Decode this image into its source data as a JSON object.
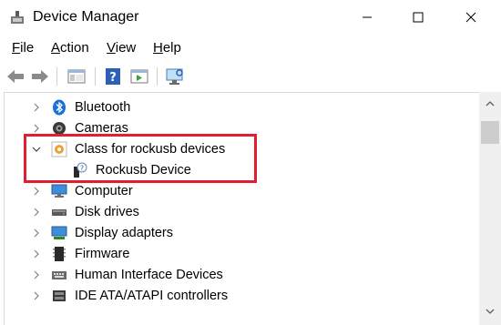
{
  "window": {
    "title": "Device Manager"
  },
  "menu": {
    "file": {
      "mnemonic": "F",
      "rest": "ile"
    },
    "action": {
      "mnemonic": "A",
      "rest": "ction"
    },
    "view": {
      "mnemonic": "V",
      "rest": "iew"
    },
    "help": {
      "mnemonic": "H",
      "rest": "elp"
    }
  },
  "toolbar": {
    "buttons": [
      "back-icon",
      "forward-icon",
      "show-hide-console-tree-icon",
      "help-icon",
      "properties-icon",
      "scan-hardware-icon"
    ]
  },
  "tree": {
    "bluetooth": "Bluetooth",
    "cameras": "Cameras",
    "rockusb_class": "Class for rockusb devices",
    "rockusb_device": "Rockusb Device",
    "computer": "Computer",
    "disk_drives": "Disk drives",
    "display_adapters": "Display adapters",
    "firmware": "Firmware",
    "hid": "Human Interface Devices",
    "ide": "IDE ATA/ATAPI controllers"
  },
  "colors": {
    "highlight_border": "#e02030",
    "bluetooth": "#1a6fd8",
    "chevron": "#808080"
  }
}
